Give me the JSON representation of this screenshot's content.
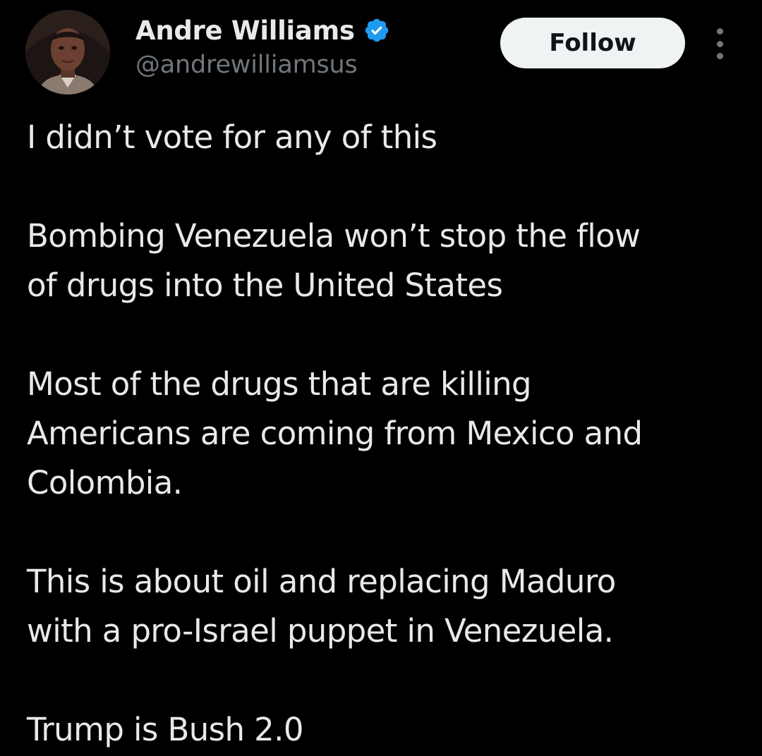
{
  "author": {
    "display_name": "Andre Williams",
    "handle": "@andrewilliamsus",
    "verified": true,
    "verified_color": "#1d9bf0",
    "avatar_icon": "profile-photo"
  },
  "actions": {
    "follow_label": "Follow",
    "more_icon": "more-vertical-icon"
  },
  "tweet": {
    "paragraphs": [
      {
        "lines": [
          "I didn’t vote for any of this"
        ]
      },
      {
        "lines": [
          "Bombing Venezuela won’t stop the flow",
          "of drugs into the United States"
        ]
      },
      {
        "lines": [
          "Most of the drugs that are killing",
          "Americans are coming from Mexico and",
          "Colombia."
        ]
      },
      {
        "lines": [
          "This is about oil and replacing Maduro",
          "with a pro-Israel puppet in Venezuela."
        ]
      },
      {
        "lines": [
          "Trump is Bush 2.0"
        ]
      }
    ]
  },
  "theme": {
    "background": "#000000",
    "text_primary": "#e7e9ea",
    "text_secondary": "#71767b",
    "button_bg": "#eff3f4",
    "button_text": "#0f1419"
  }
}
